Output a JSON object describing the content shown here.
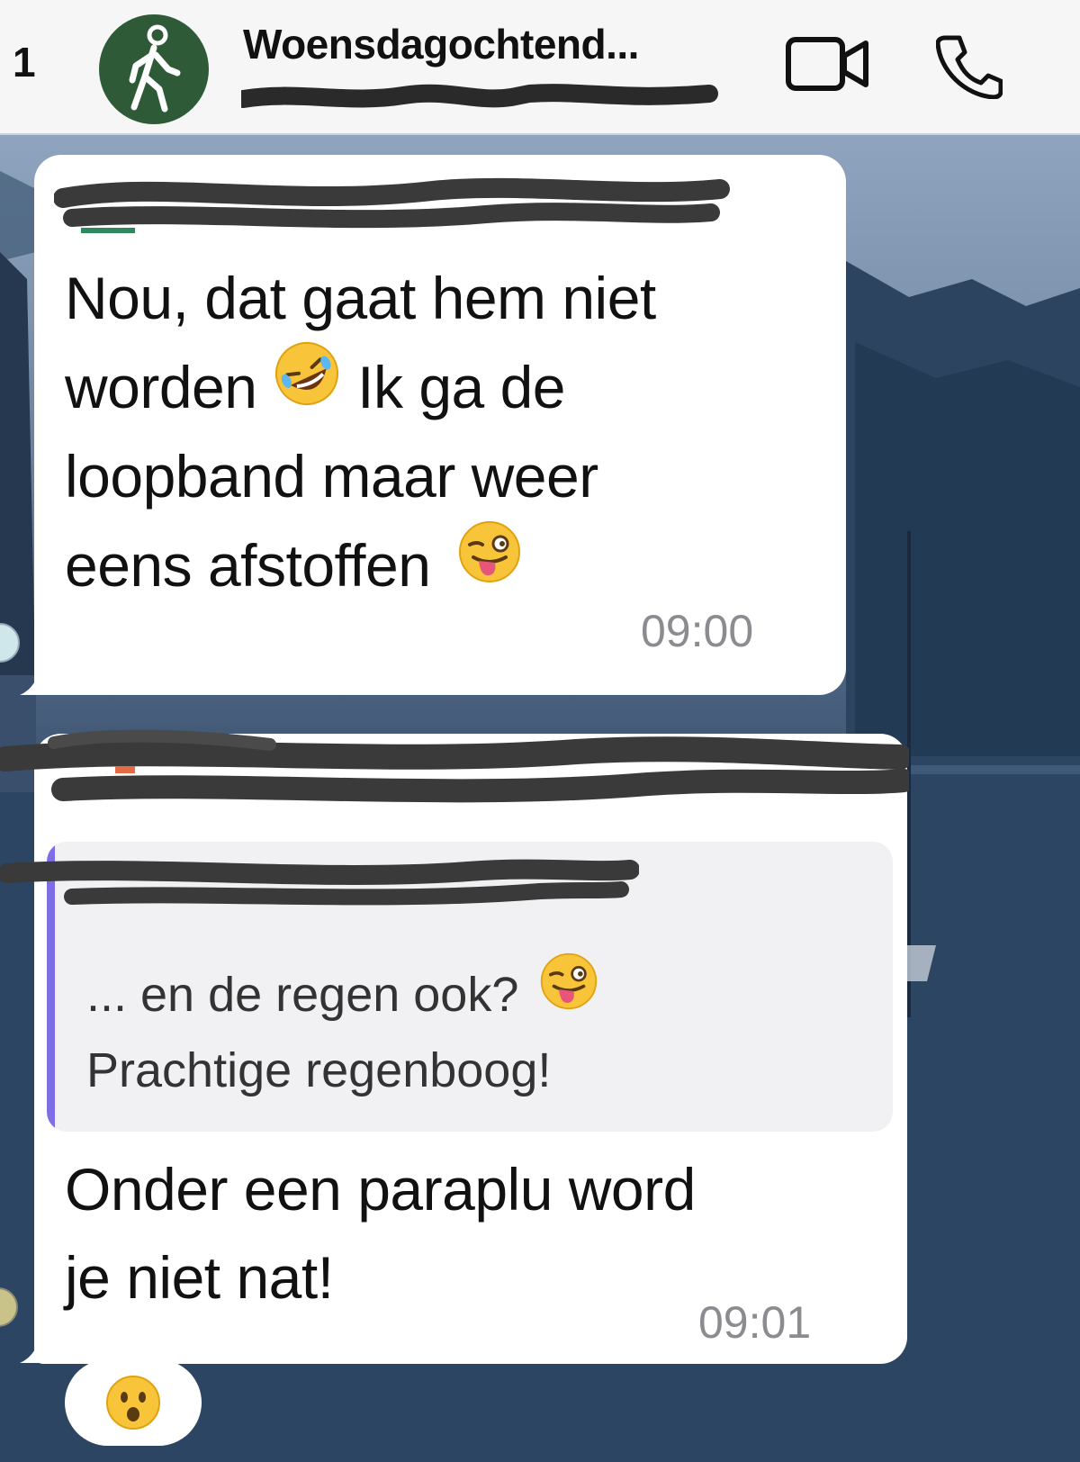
{
  "header": {
    "back_count": "1",
    "title": "Woensdagochtend..."
  },
  "messages": [
    {
      "lines": [
        "Nou, dat gaat hem niet",
        "worden",
        "Ik ga de",
        "loopband maar weer",
        "eens afstoffen"
      ],
      "time": "09:00"
    },
    {
      "quote": {
        "line1": "... en de regen ook?",
        "line2": "Prachtige regenboog!"
      },
      "lines": [
        "Onder een paraplu word",
        "je niet nat!"
      ],
      "time": "09:01"
    }
  ],
  "icons": {
    "avatar": "walking-person-icon",
    "video": "video-camera-icon",
    "call": "phone-icon",
    "emoji_rofl": "rolling-on-floor-laughing-emoji",
    "emoji_wink": "winking-face-with-tongue-emoji",
    "emoji_surprised": "surprised-face-emoji"
  },
  "colors": {
    "avatar_bg": "#2f5a37",
    "quote_bar": "#7d6ee6",
    "quote_author": "#7a64d8",
    "timestamp": "#8b8b90"
  }
}
